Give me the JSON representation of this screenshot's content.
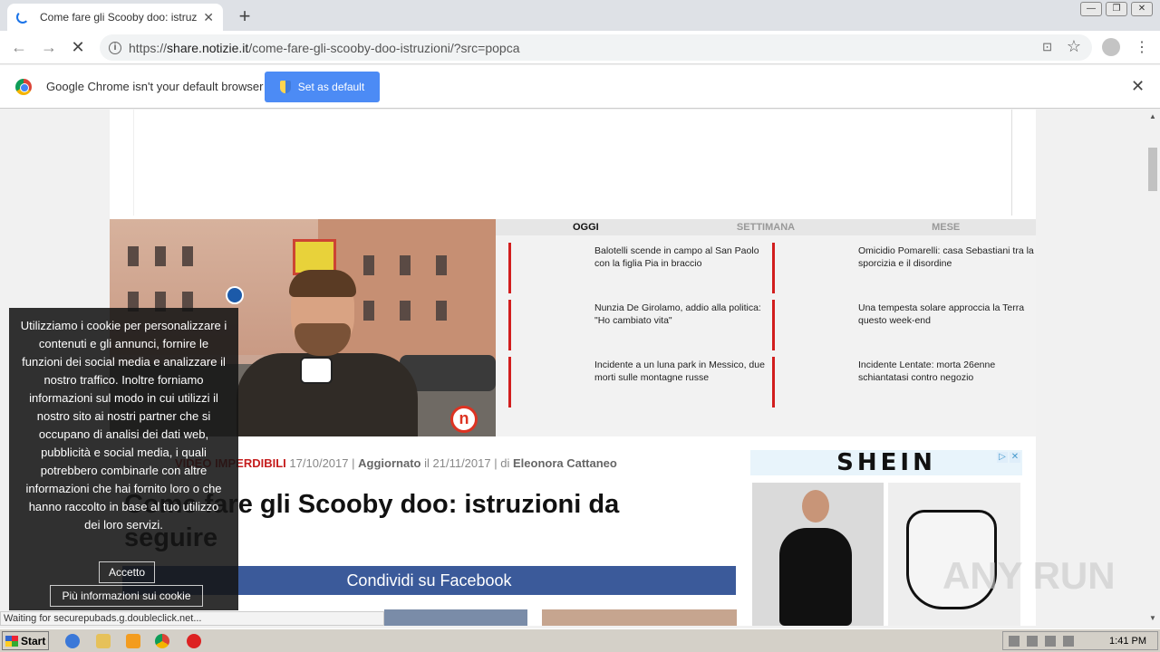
{
  "browser": {
    "tab_title": "Come fare gli Scooby doo: istruzioni",
    "tab_close": "✕",
    "new_tab": "+",
    "window_controls": [
      "—",
      "❐",
      "✕"
    ],
    "url_scheme": "https://",
    "url_host": "share.notizie.it",
    "url_path": "/come-fare-gli-scooby-doo-istruzioni/?src=popca",
    "back": "←",
    "forward": "→",
    "reload": "✕",
    "menu": "⋮",
    "star": "☆",
    "translate": "⊡"
  },
  "infobar": {
    "text": "Google Chrome isn't your default browser",
    "button": "Set as default",
    "close": "✕"
  },
  "trending": {
    "tabs": [
      "OGGI",
      "SETTIMANA",
      "MESE"
    ],
    "items": [
      "Balotelli scende in campo al San Paolo con la figlia Pia in braccio",
      "Omicidio Pomarelli: casa Sebastiani tra la sporcizia e il disordine",
      "Nunzia De Girolamo, addio alla politica: \"Ho cambiato vita\"",
      "Una tempesta solare approccia la Terra questo week-end",
      "Incidente a un luna park in Messico, due morti sulle montagne russe",
      "Incidente Lentate: morta 26enne schiantatasi contro negozio"
    ]
  },
  "article": {
    "category": "VIDEO IMPERDIBILI",
    "date": "17/10/2017",
    "updated_label": "Aggiornato",
    "updated_il": "il",
    "updated_date": "21/11/2017",
    "by": "di",
    "author": "Eleonora Cattaneo",
    "title": "Come fare gli Scooby doo: istruzioni da seguire",
    "share_button": "Condividi su Facebook",
    "sep": "|"
  },
  "ad": {
    "brand": "SHEIN",
    "adchoices": "▷",
    "close": "✕"
  },
  "video": {
    "logo": "n"
  },
  "cookie": {
    "message": "Utilizziamo i cookie per personalizzare i contenuti e gli annunci, fornire le funzioni dei social media e analizzare il nostro traffico. Inoltre forniamo informazioni sul modo in cui utilizzi il nostro sito ai nostri partner che si occupano di analisi dei dati web, pubblicità e social media, i quali potrebbero combinarle con altre informazioni che hai fornito loro o che hanno raccolto in base al tuo utilizzo dei loro servizi.",
    "accept": "Accetto",
    "more": "Più informazioni sui cookie"
  },
  "status": "Waiting for securepubads.g.doubleclick.net...",
  "watermark": "ANY RUN",
  "taskbar": {
    "start": "Start",
    "time": "1:41 PM"
  }
}
